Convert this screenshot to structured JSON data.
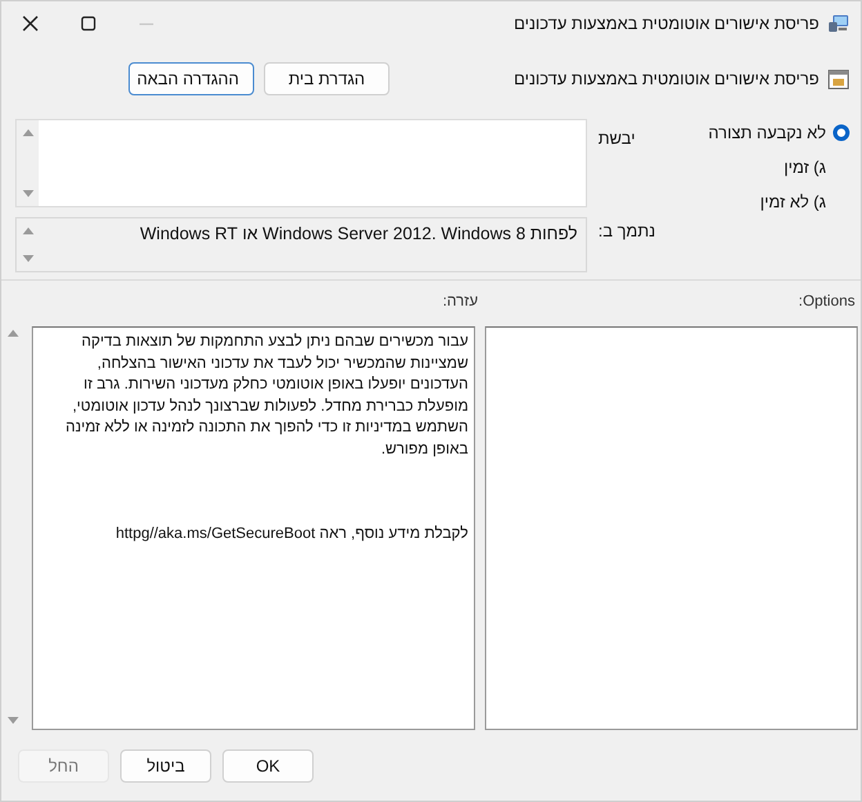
{
  "window": {
    "title": "פריסת אישורים אוטומטית באמצעות עדכונים",
    "controls": [
      {
        "kind": "close",
        "disabled": false
      },
      {
        "kind": "maximize",
        "disabled": false
      },
      {
        "kind": "minimize",
        "disabled": true
      }
    ]
  },
  "header": {
    "title": "פריסת אישורים אוטומטית באמצעות עדכונים"
  },
  "nav_buttons": [
    {
      "label": "הגדרת בית",
      "focused": false
    },
    {
      "label": "ההגדרה הבאה",
      "focused": true
    }
  ],
  "states": [
    {
      "label": "לא נקבעה תצורה",
      "selected": true
    },
    {
      "label": "ג) זמין",
      "selected": false
    },
    {
      "label": "ג) לא זמין",
      "selected": false
    }
  ],
  "comment": {
    "label": "יבשת"
  },
  "supported_on": {
    "label": "נתמך ב:",
    "value": "לפחות Windows Server 2012. Windows 8 או Windows RT"
  },
  "options_label": "Options:",
  "help": {
    "label": "עזרה:",
    "paragraphs": [
      "עבור מכשירים שבהם ניתן לבצע התחמקות של תוצאות בדיקה שמציינות שהמכשיר יכול לעבד את עדכוני האישור בהצלחה, העדכונים יופעלו באופן אוטומטי כחלק מעדכוני השירות. גרב זו מופעלת כברירת מחדל. לפעולות שברצונך לנהל עדכון אוטומטי, השתמש במדיניות זו כדי להפוך את התכונה לזמינה או ללא זמינה באופן מפורש.",
      "לקבלת מידע נוסף, ראה httpg//aka.ms/GetSecureBoot"
    ]
  },
  "footer_buttons": [
    {
      "label": "OK",
      "disabled": false
    },
    {
      "label": "ביטול",
      "disabled": false
    },
    {
      "label": "החל",
      "disabled": true
    }
  ]
}
